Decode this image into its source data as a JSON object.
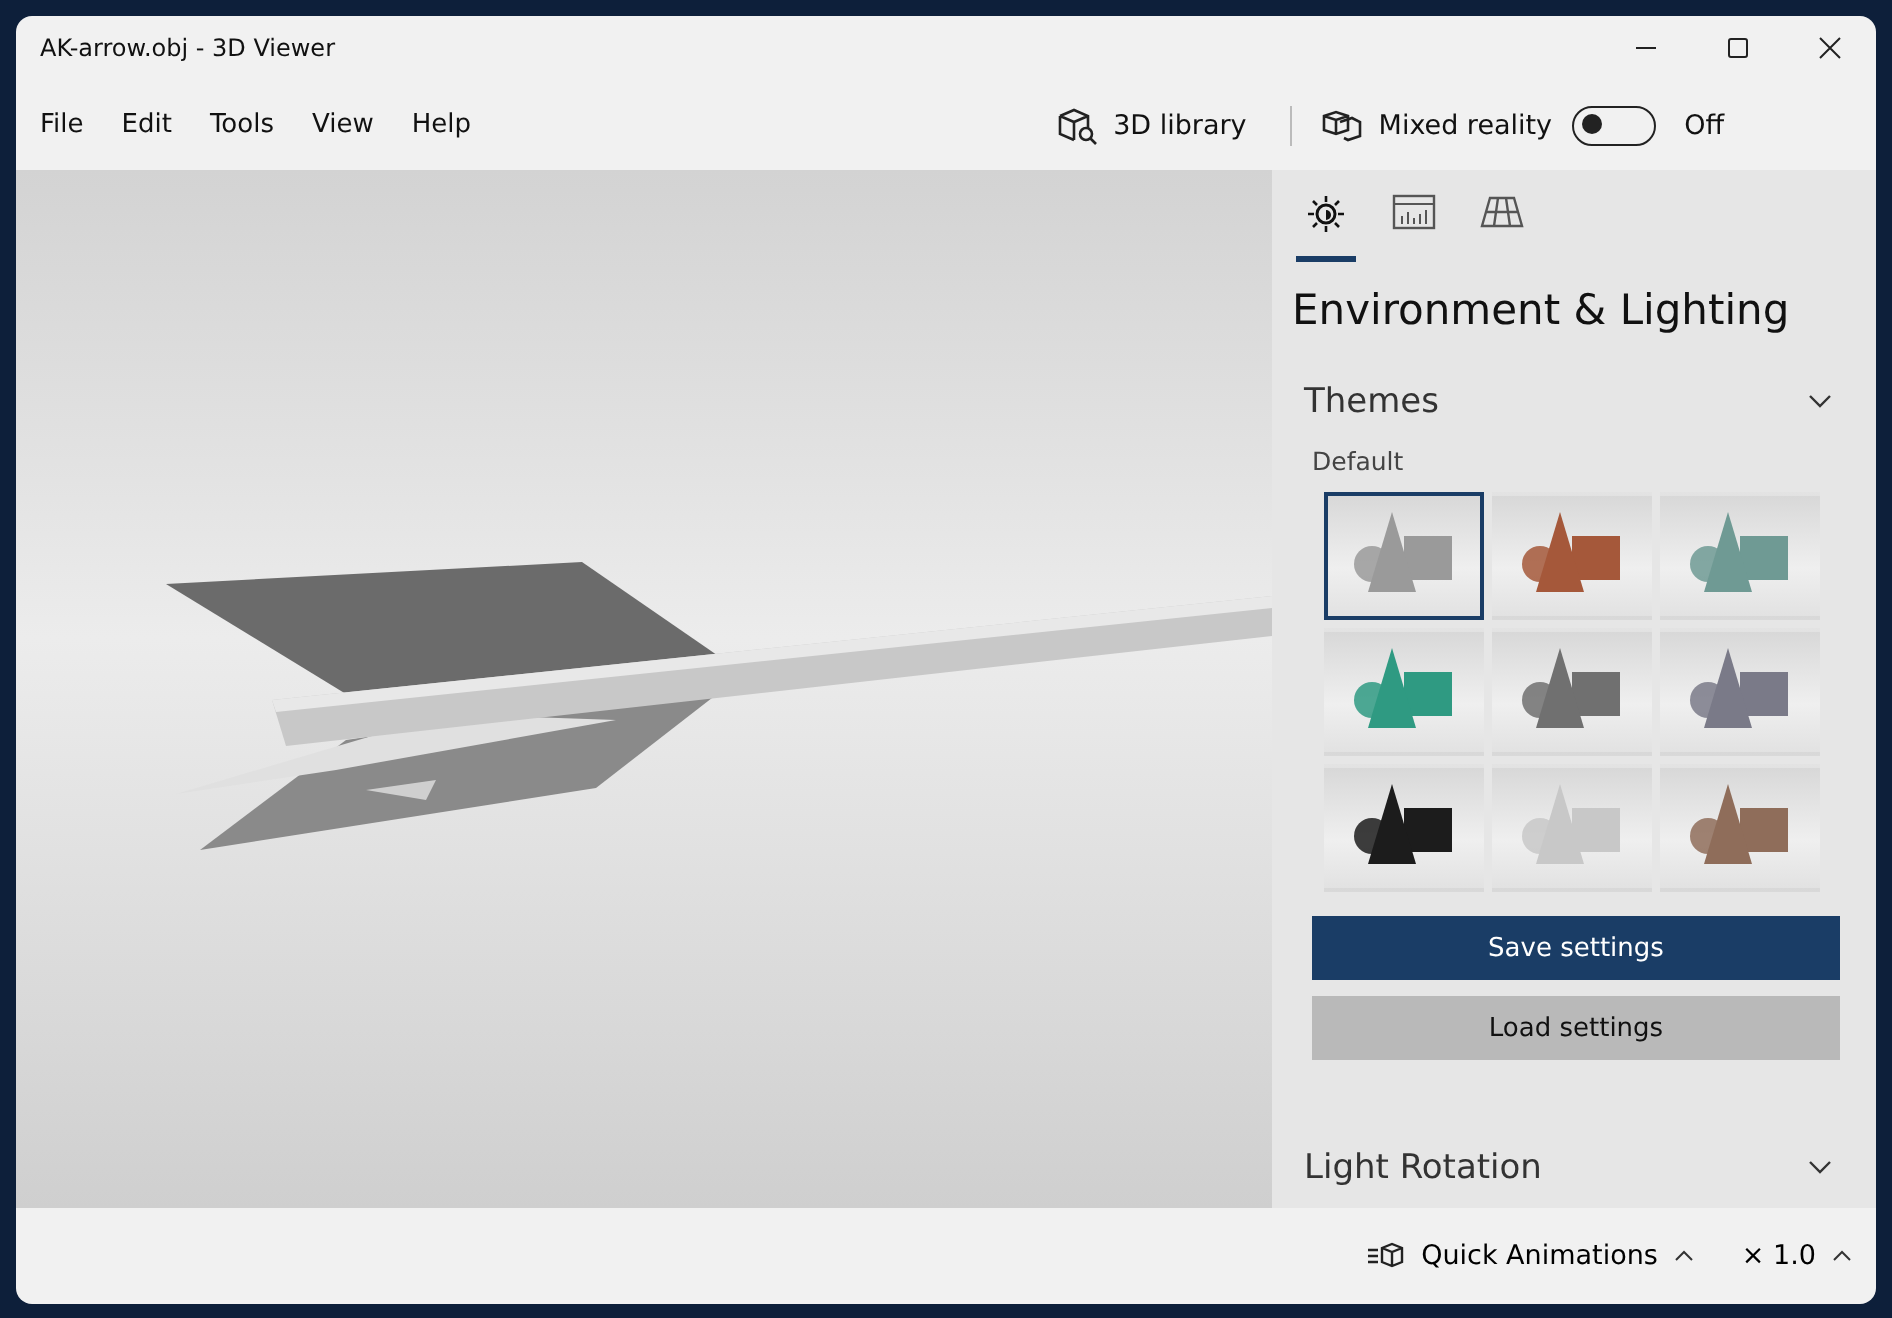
{
  "window": {
    "title": "AK-arrow.obj - 3D Viewer"
  },
  "menu": [
    "File",
    "Edit",
    "Tools",
    "View",
    "Help"
  ],
  "toolbar": {
    "library_label": "3D library",
    "mixed_reality_label": "Mixed reality",
    "mixed_reality_on": false,
    "mixed_reality_state": "Off"
  },
  "panel": {
    "tabs": [
      {
        "kind": "lighting",
        "selected": true
      },
      {
        "kind": "stats",
        "selected": false
      },
      {
        "kind": "grid",
        "selected": false
      }
    ],
    "title": "Environment & Lighting",
    "themes": {
      "heading": "Themes",
      "expanded": true,
      "subheading": "Default",
      "items": [
        {
          "color": "#9a9a9a",
          "selected": true
        },
        {
          "color": "#a5583a",
          "selected": false
        },
        {
          "color": "#6f9a94",
          "selected": false
        },
        {
          "color": "#2f9a82",
          "selected": false
        },
        {
          "color": "#707070",
          "selected": false
        },
        {
          "color": "#7a7a88",
          "selected": false
        },
        {
          "color": "#1c1c1c",
          "selected": false
        },
        {
          "color": "#c8c8c8",
          "selected": false
        },
        {
          "color": "#8f6d5a",
          "selected": false
        }
      ]
    },
    "buttons": [
      {
        "kind": "primary",
        "label": "Save settings"
      },
      {
        "kind": "secondary",
        "label": "Load settings"
      }
    ],
    "next_section": {
      "heading": "Light Rotation"
    }
  },
  "status_bar": {
    "animations_label": "Quick Animations",
    "speed": "× 1.0"
  }
}
